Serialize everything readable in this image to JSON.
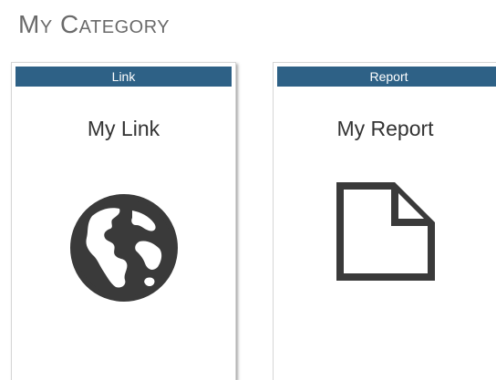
{
  "category": {
    "title": "My Category"
  },
  "cards": [
    {
      "header": "Link",
      "title": "My Link",
      "icon": "globe-icon"
    },
    {
      "header": "Report",
      "title": "My Report",
      "icon": "document-icon"
    }
  ],
  "colors": {
    "header_bg": "#2e6186",
    "title_text": "#6a6a6a",
    "icon": "#3a3a3a"
  }
}
